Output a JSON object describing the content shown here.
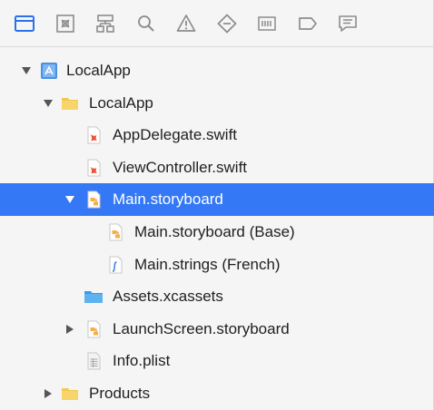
{
  "toolbar": {
    "tabs": [
      {
        "id": "project",
        "icon": "folder-icon",
        "active": true
      },
      {
        "id": "source-control",
        "icon": "source-control-icon"
      },
      {
        "id": "symbols",
        "icon": "symbol-hierarchy-icon"
      },
      {
        "id": "find",
        "icon": "search-icon"
      },
      {
        "id": "issues",
        "icon": "warning-icon"
      },
      {
        "id": "tests",
        "icon": "diamond-icon"
      },
      {
        "id": "debug",
        "icon": "debug-bars-icon"
      },
      {
        "id": "breakpoints",
        "icon": "breakpoint-icon"
      },
      {
        "id": "reports",
        "icon": "report-bubble-icon"
      }
    ],
    "accent": "#2b72ea",
    "inactive_color": "#8c8c8c"
  },
  "tree": {
    "selected_color": "#3478f6",
    "items": [
      {
        "label": "LocalApp",
        "icon": "xcode-project-icon",
        "disclosure": "open"
      },
      {
        "label": "LocalApp",
        "icon": "folder-icon",
        "disclosure": "open"
      },
      {
        "label": "AppDelegate.swift",
        "icon": "swift-file-icon"
      },
      {
        "label": "ViewController.swift",
        "icon": "swift-file-icon"
      },
      {
        "label": "Main.storyboard",
        "icon": "storyboard-icon",
        "disclosure": "open",
        "selected": true
      },
      {
        "label": "Main.storyboard (Base)",
        "icon": "storyboard-icon"
      },
      {
        "label": "Main.strings (French)",
        "icon": "strings-file-icon"
      },
      {
        "label": "Assets.xcassets",
        "icon": "asset-catalog-icon"
      },
      {
        "label": "LaunchScreen.storyboard",
        "icon": "storyboard-icon",
        "disclosure": "closed"
      },
      {
        "label": "Info.plist",
        "icon": "plist-icon"
      },
      {
        "label": "Products",
        "icon": "folder-icon",
        "disclosure": "closed"
      }
    ]
  }
}
